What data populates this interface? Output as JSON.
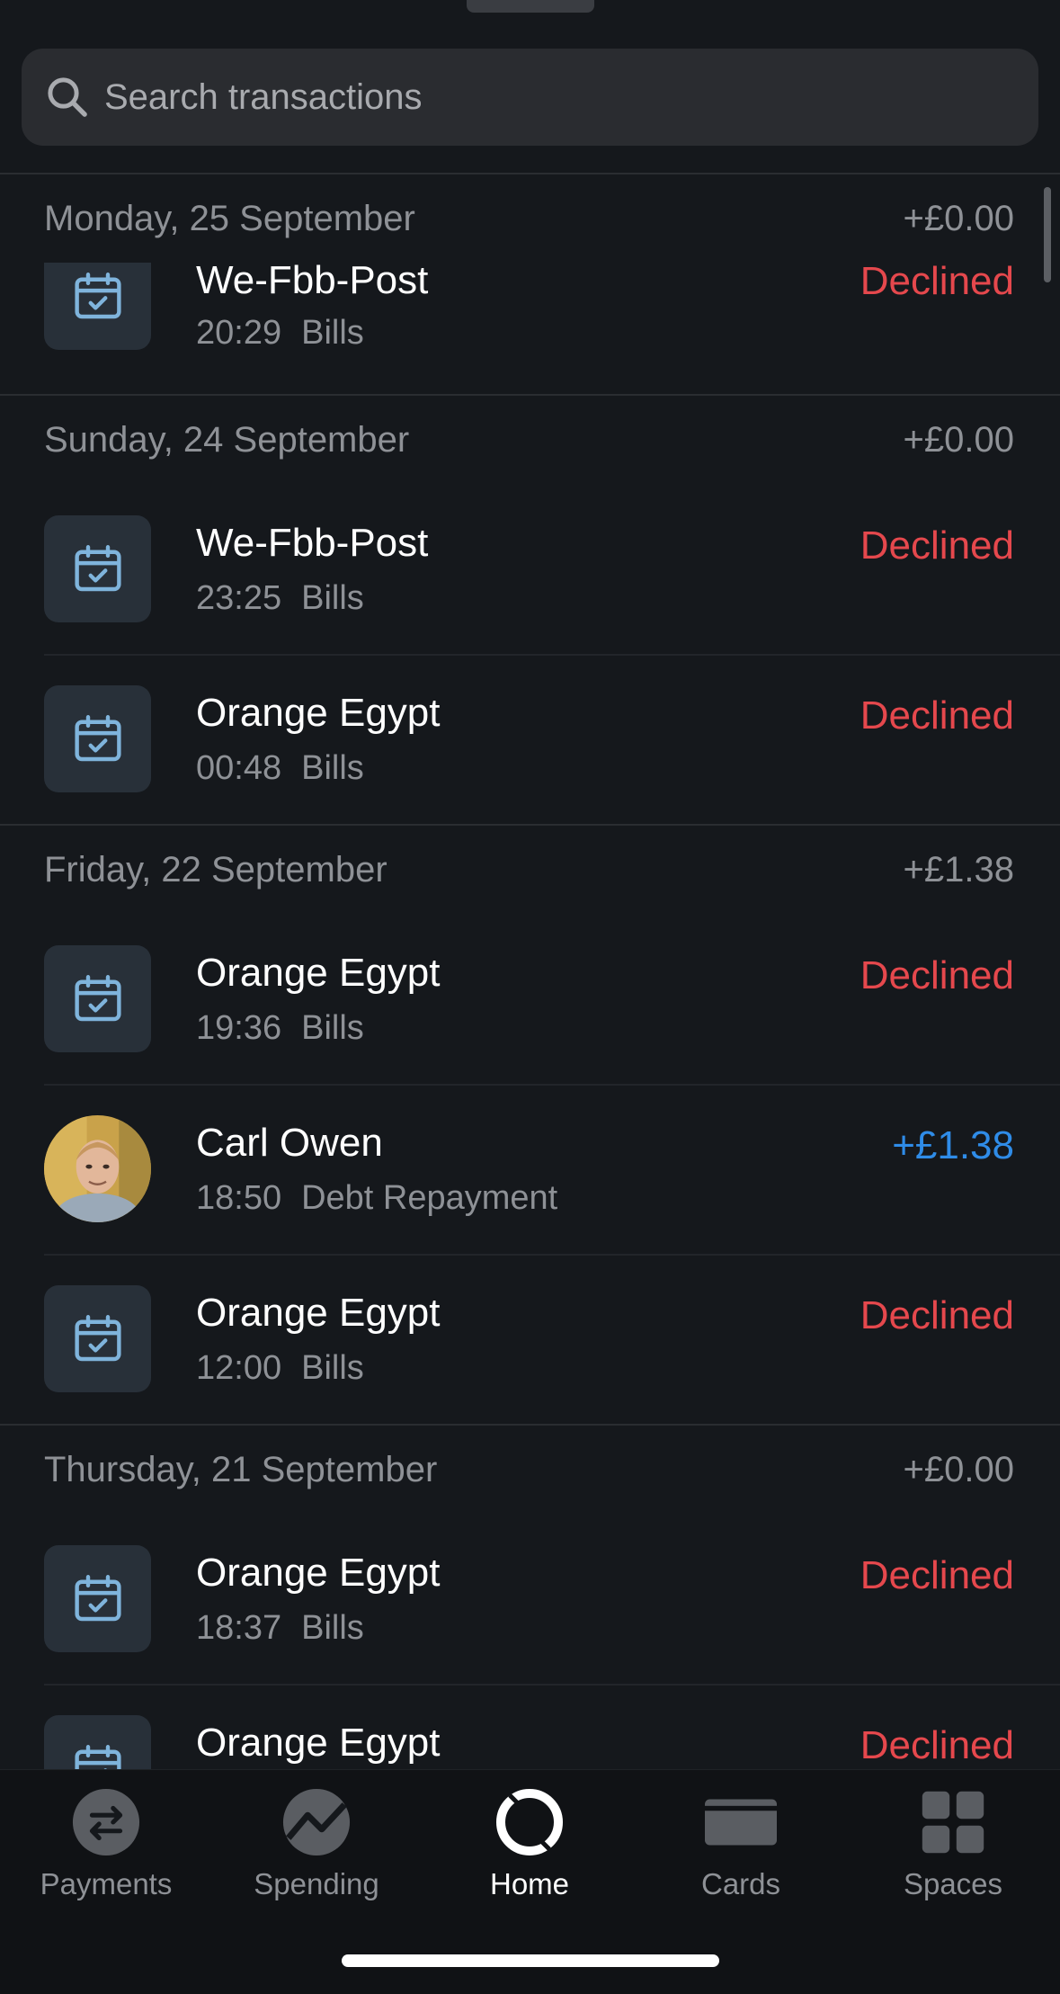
{
  "search": {
    "placeholder": "Search transactions"
  },
  "groups": [
    {
      "date": "Monday, 25 September",
      "total": "+£0.00",
      "items": [
        {
          "name": "We-Fbb-Post",
          "time": "20:29",
          "category": "Bills",
          "amount": "Declined"
        }
      ]
    },
    {
      "date": "Sunday, 24 September",
      "total": "+£0.00",
      "items": [
        {
          "name": "We-Fbb-Post",
          "time": "23:25",
          "category": "Bills",
          "amount": "Declined"
        },
        {
          "name": "Orange Egypt",
          "time": "00:48",
          "category": "Bills",
          "amount": "Declined"
        }
      ]
    },
    {
      "date": "Friday, 22 September",
      "total": "+£1.38",
      "items": [
        {
          "name": "Orange Egypt",
          "time": "19:36",
          "category": "Bills",
          "amount": "Declined"
        },
        {
          "name": "Carl Owen",
          "time": "18:50",
          "category": "Debt Repayment",
          "amount": "+£1.38"
        },
        {
          "name": "Orange Egypt",
          "time": "12:00",
          "category": "Bills",
          "amount": "Declined"
        }
      ]
    },
    {
      "date": "Thursday, 21 September",
      "total": "+£0.00",
      "items": [
        {
          "name": "Orange Egypt",
          "time": "18:37",
          "category": "Bills",
          "amount": "Declined"
        },
        {
          "name": "Orange Egypt",
          "time": "",
          "category": "",
          "amount": "Declined"
        }
      ]
    }
  ],
  "tabs": [
    {
      "label": "Payments",
      "icon": "transfer-arrows-icon"
    },
    {
      "label": "Spending",
      "icon": "trend-chart-icon"
    },
    {
      "label": "Home",
      "icon": "home-ring-icon",
      "active": true
    },
    {
      "label": "Cards",
      "icon": "card-icon"
    },
    {
      "label": "Spaces",
      "icon": "grid-icon"
    }
  ],
  "colors": {
    "declined": "#e5484d",
    "credit": "#2f8ce8",
    "background": "#15181c"
  }
}
